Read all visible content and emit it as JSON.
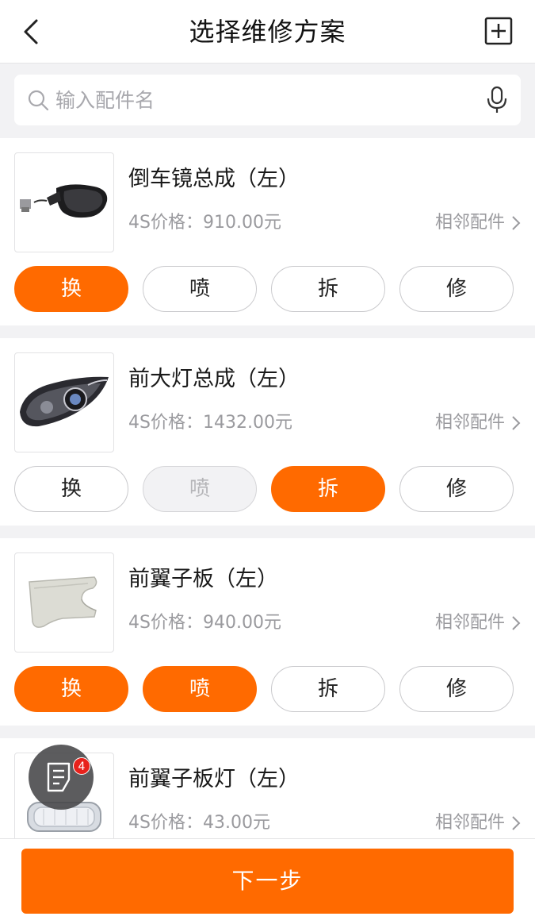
{
  "header": {
    "title": "选择维修方案"
  },
  "search": {
    "placeholder": "输入配件名"
  },
  "parts": [
    {
      "name": "倒车镜总成（左）",
      "price": "4S价格：910.00元",
      "adjacent_label": "相邻配件",
      "actions": [
        {
          "label": "换",
          "state": "selected"
        },
        {
          "label": "喷",
          "state": "normal"
        },
        {
          "label": "拆",
          "state": "normal"
        },
        {
          "label": "修",
          "state": "normal"
        }
      ]
    },
    {
      "name": "前大灯总成（左）",
      "price": "4S价格：1432.00元",
      "adjacent_label": "相邻配件",
      "actions": [
        {
          "label": "换",
          "state": "normal"
        },
        {
          "label": "喷",
          "state": "disabled"
        },
        {
          "label": "拆",
          "state": "selected"
        },
        {
          "label": "修",
          "state": "normal"
        }
      ]
    },
    {
      "name": "前翼子板（左）",
      "price": "4S价格：940.00元",
      "adjacent_label": "相邻配件",
      "actions": [
        {
          "label": "换",
          "state": "selected"
        },
        {
          "label": "喷",
          "state": "selected"
        },
        {
          "label": "拆",
          "state": "normal"
        },
        {
          "label": "修",
          "state": "normal"
        }
      ]
    },
    {
      "name": "前翼子板灯（左）",
      "price": "4S价格：43.00元",
      "adjacent_label": "相邻配件",
      "actions": []
    }
  ],
  "floating": {
    "badge_count": "4",
    "icon": "list-icon"
  },
  "footer": {
    "next_label": "下一步"
  },
  "colors": {
    "accent": "#ff6a00",
    "badge": "#e8221c"
  }
}
